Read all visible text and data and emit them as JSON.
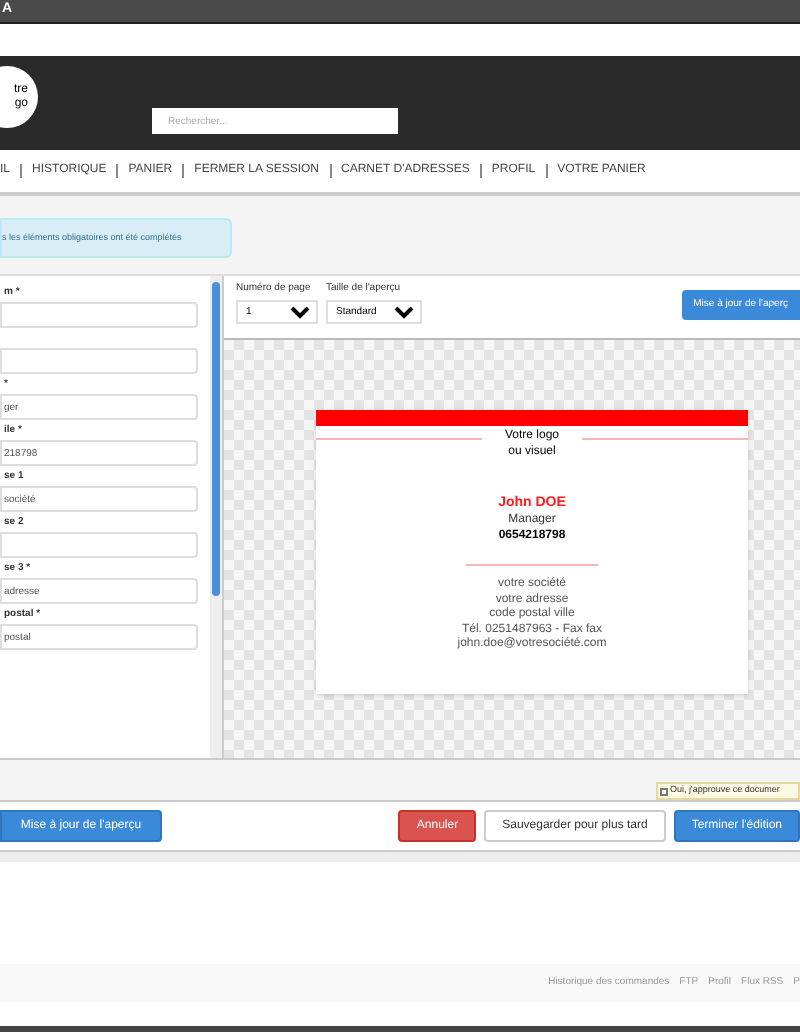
{
  "window": {
    "title": "A"
  },
  "logo": {
    "lines": [
      "tre",
      "go"
    ]
  },
  "search": {
    "placeholder": "Rechercher..."
  },
  "nav": [
    {
      "label": "IL"
    },
    {
      "label": "HISTORIQUE"
    },
    {
      "label": "PANIER"
    },
    {
      "label": "FERMER LA SESSION"
    },
    {
      "label": "CARNET D'ADRESSES"
    },
    {
      "label": "PROFIL"
    },
    {
      "label": "VOTRE PANIER"
    }
  ],
  "alert": "s les éléments obligatoires ont été complétés",
  "form": [
    {
      "kind": "text",
      "label": "m *"
    },
    {
      "kind": "text"
    },
    {
      "kind": "text",
      "label": "*",
      "value": "ger"
    },
    {
      "kind": "text",
      "label": "ile *",
      "value": "218798"
    },
    {
      "kind": "text",
      "label": "se 1",
      "value": "société"
    },
    {
      "kind": "text",
      "label": "se 2"
    },
    {
      "kind": "text",
      "label": "se 3 *",
      "value": "adresse"
    },
    {
      "kind": "text",
      "label": "postal *",
      "value": "postal"
    }
  ],
  "toolbar": {
    "page_label": "Numéro de page",
    "page_value": "1",
    "size_label": "Taille de l'aperçu",
    "size_value": "Standard",
    "update_button": "Mise à jour de l'aperç"
  },
  "card": {
    "logo_lines": [
      "Votre logo",
      "ou visuel"
    ],
    "name": "John DOE",
    "title": "Manager",
    "phone": "0654218798",
    "address_lines": [
      "votre société",
      "votre adresse",
      "code postal ville",
      "Tél. 0251487963 - Fax fax",
      "john.doe@votresociété.com"
    ]
  },
  "approve": {
    "label": "Oui, j'approuve ce documer",
    "checked": false
  },
  "buttons": [
    {
      "kind": "primary",
      "label": "Mise à jour de l'aperçu"
    },
    {
      "kind": "danger",
      "label": "Annuler"
    },
    {
      "kind": "default",
      "label": "Sauvegarder pour plus tard"
    },
    {
      "kind": "primary",
      "label": "Terminer l'édition"
    }
  ],
  "footer_links": [
    "Historique des commandes",
    "FTP",
    "Profil",
    "Flux RSS",
    "P"
  ]
}
